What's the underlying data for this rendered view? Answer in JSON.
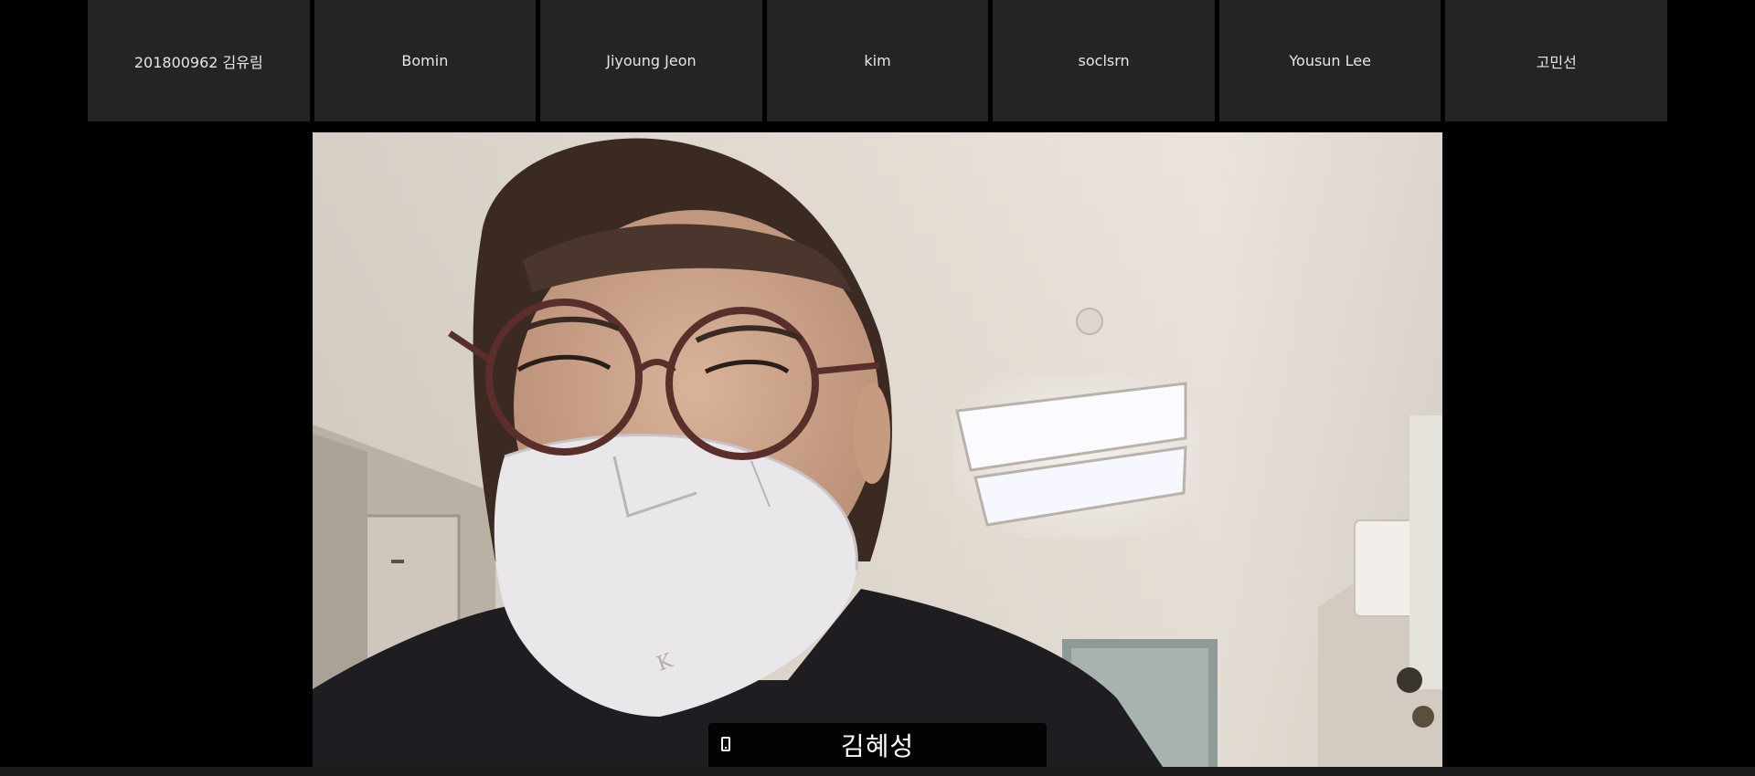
{
  "participants": [
    {
      "name": "201800962 김유림"
    },
    {
      "name": "Bomin"
    },
    {
      "name": "Jiyoung Jeon"
    },
    {
      "name": "kim"
    },
    {
      "name": "soclsrn"
    },
    {
      "name": "Yousun Lee"
    },
    {
      "name": "고민선"
    }
  ],
  "active_speaker": {
    "name": "김혜성",
    "device_icon": "phone-icon"
  },
  "colors": {
    "background": "#000000",
    "tile_background": "#242424",
    "tile_text": "#e6e6e6",
    "name_tag_background": "#000000"
  }
}
